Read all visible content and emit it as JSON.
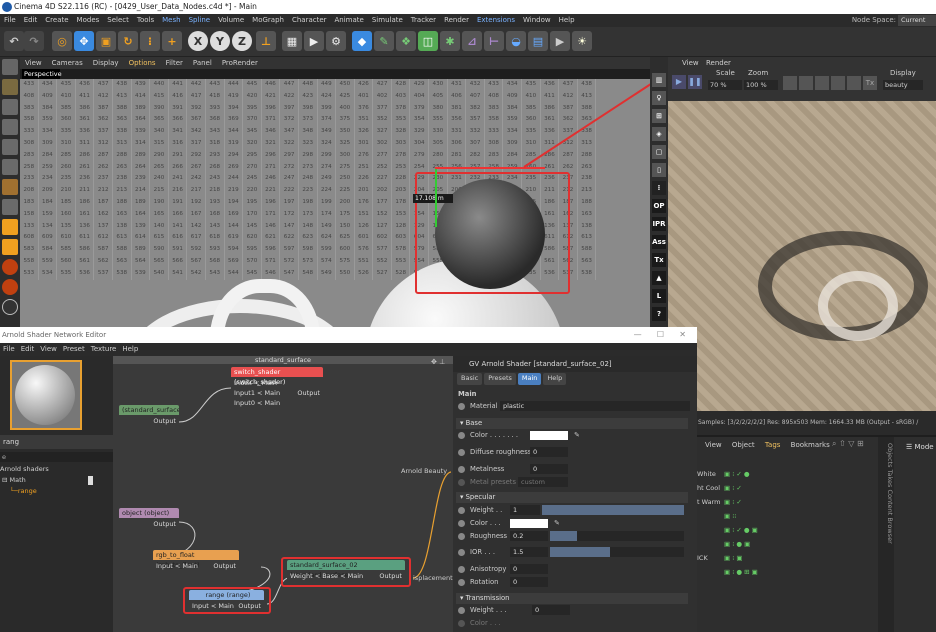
{
  "window": {
    "title": "Cinema 4D S22.116 (RC) - [0429_User_Data_Nodes.c4d *] - Main",
    "node_space_label": "Node Space:",
    "node_space_value": "Current"
  },
  "menu": [
    "File",
    "Edit",
    "Create",
    "Modes",
    "Select",
    "Tools",
    "Mesh",
    "Spline",
    "Volume",
    "MoGraph",
    "Character",
    "Animate",
    "Simulate",
    "Tracker",
    "Render",
    "Extensions",
    "Window",
    "Help"
  ],
  "menu_highlight": [
    "Mesh",
    "Spline",
    "Extensions"
  ],
  "viewport": {
    "menu": [
      "View",
      "Cameras",
      "Display",
      "Options",
      "Filter",
      "Panel",
      "ProRender"
    ],
    "label": "Perspective",
    "grid_rows": [
      [
        "433",
        "434",
        "435",
        "436",
        "437",
        "438",
        "439",
        "440",
        "441",
        "442",
        "443",
        "444",
        "445",
        "446",
        "447",
        "448",
        "449",
        "450",
        "426",
        "427",
        "428",
        "429",
        "430",
        "431",
        "432",
        "433",
        "434",
        "435",
        "436",
        "437",
        "438"
      ],
      [
        "408",
        "409",
        "410",
        "411",
        "412",
        "413",
        "414",
        "415",
        "416",
        "417",
        "418",
        "419",
        "420",
        "421",
        "422",
        "423",
        "424",
        "425",
        "401",
        "402",
        "403",
        "404",
        "405",
        "406",
        "407",
        "408",
        "409",
        "410",
        "411",
        "412",
        "413"
      ],
      [
        "383",
        "384",
        "385",
        "386",
        "387",
        "388",
        "389",
        "390",
        "391",
        "392",
        "393",
        "394",
        "395",
        "396",
        "397",
        "398",
        "399",
        "400",
        "376",
        "377",
        "378",
        "379",
        "380",
        "381",
        "382",
        "383",
        "384",
        "385",
        "386",
        "387",
        "388"
      ],
      [
        "358",
        "359",
        "360",
        "361",
        "362",
        "363",
        "364",
        "365",
        "366",
        "367",
        "368",
        "369",
        "370",
        "371",
        "372",
        "373",
        "374",
        "375",
        "351",
        "352",
        "353",
        "354",
        "355",
        "356",
        "357",
        "358",
        "359",
        "360",
        "361",
        "362",
        "363"
      ],
      [
        "333",
        "334",
        "335",
        "336",
        "337",
        "338",
        "339",
        "340",
        "341",
        "342",
        "343",
        "344",
        "345",
        "346",
        "347",
        "348",
        "349",
        "350",
        "326",
        "327",
        "328",
        "329",
        "330",
        "331",
        "332",
        "333",
        "334",
        "335",
        "336",
        "337",
        "338"
      ],
      [
        "308",
        "309",
        "310",
        "311",
        "312",
        "313",
        "314",
        "315",
        "316",
        "317",
        "318",
        "319",
        "320",
        "321",
        "322",
        "323",
        "324",
        "325",
        "301",
        "302",
        "303",
        "304",
        "305",
        "306",
        "307",
        "308",
        "309",
        "310",
        "311",
        "312",
        "313"
      ],
      [
        "283",
        "284",
        "285",
        "286",
        "287",
        "288",
        "289",
        "290",
        "291",
        "292",
        "293",
        "294",
        "295",
        "296",
        "297",
        "298",
        "299",
        "300",
        "276",
        "277",
        "278",
        "279",
        "280",
        "281",
        "282",
        "283",
        "284",
        "285",
        "286",
        "287",
        "288"
      ],
      [
        "258",
        "259",
        "260",
        "261",
        "262",
        "263",
        "264",
        "265",
        "266",
        "267",
        "268",
        "269",
        "270",
        "271",
        "272",
        "273",
        "274",
        "275",
        "251",
        "252",
        "253",
        "254",
        "255",
        "256",
        "257",
        "258",
        "259",
        "260",
        "261",
        "262",
        "263"
      ],
      [
        "233",
        "234",
        "235",
        "236",
        "237",
        "238",
        "239",
        "240",
        "241",
        "242",
        "243",
        "244",
        "245",
        "246",
        "247",
        "248",
        "249",
        "250",
        "226",
        "227",
        "228",
        "229",
        "230",
        "231",
        "232",
        "233",
        "234",
        "235",
        "236",
        "237",
        "238"
      ],
      [
        "208",
        "209",
        "210",
        "211",
        "212",
        "213",
        "214",
        "215",
        "216",
        "217",
        "218",
        "219",
        "220",
        "221",
        "222",
        "223",
        "224",
        "225",
        "201",
        "202",
        "203",
        "204",
        "205",
        "206",
        "207",
        "208",
        "209",
        "210",
        "211",
        "212",
        "213"
      ],
      [
        "183",
        "184",
        "185",
        "186",
        "187",
        "188",
        "189",
        "190",
        "191",
        "192",
        "193",
        "194",
        "195",
        "196",
        "197",
        "198",
        "199",
        "200",
        "176",
        "177",
        "178",
        "179",
        "180",
        "181",
        "182",
        "183",
        "184",
        "185",
        "186",
        "187",
        "188"
      ],
      [
        "158",
        "159",
        "160",
        "161",
        "162",
        "163",
        "164",
        "165",
        "166",
        "167",
        "168",
        "169",
        "170",
        "171",
        "172",
        "173",
        "174",
        "175",
        "151",
        "152",
        "153",
        "154",
        "155",
        "156",
        "157",
        "158",
        "159",
        "160",
        "161",
        "162",
        "163"
      ],
      [
        "133",
        "134",
        "135",
        "136",
        "137",
        "138",
        "139",
        "140",
        "141",
        "142",
        "143",
        "144",
        "145",
        "146",
        "147",
        "148",
        "149",
        "150",
        "126",
        "127",
        "128",
        "129",
        "130",
        "131",
        "132",
        "133",
        "134",
        "135",
        "136",
        "137",
        "138"
      ],
      [
        "608",
        "609",
        "610",
        "611",
        "612",
        "613",
        "614",
        "615",
        "616",
        "617",
        "618",
        "619",
        "620",
        "621",
        "622",
        "623",
        "624",
        "625",
        "601",
        "602",
        "603",
        "604",
        "605",
        "606",
        "607",
        "608",
        "609",
        "610",
        "611",
        "612",
        "613"
      ],
      [
        "583",
        "584",
        "585",
        "586",
        "587",
        "588",
        "589",
        "590",
        "591",
        "592",
        "593",
        "594",
        "595",
        "596",
        "597",
        "598",
        "599",
        "600",
        "576",
        "577",
        "578",
        "579",
        "580",
        "581",
        "582",
        "583",
        "584",
        "585",
        "586",
        "587",
        "588"
      ],
      [
        "558",
        "559",
        "560",
        "561",
        "562",
        "563",
        "564",
        "565",
        "566",
        "567",
        "568",
        "569",
        "570",
        "571",
        "572",
        "573",
        "574",
        "575",
        "551",
        "552",
        "553",
        "554",
        "555",
        "556",
        "557",
        "558",
        "559",
        "560",
        "561",
        "562",
        "563"
      ],
      [
        "533",
        "534",
        "535",
        "536",
        "537",
        "538",
        "539",
        "540",
        "541",
        "542",
        "543",
        "544",
        "545",
        "546",
        "547",
        "548",
        "549",
        "550",
        "526",
        "527",
        "528",
        "529",
        "530",
        "531",
        "532",
        "533",
        "534",
        "535",
        "536",
        "537",
        "538"
      ]
    ],
    "coord_readout": "17.108 m"
  },
  "right_icons": [
    "OP",
    "IPR",
    "Ass",
    "Tx",
    "L",
    "?"
  ],
  "render": {
    "menu": [
      "View",
      "Render"
    ],
    "scale_label": "Scale",
    "scale_value": "70 %",
    "zoom_label": "Zoom",
    "zoom_value": "100 %",
    "display_label": "Display",
    "display_value": "beauty",
    "status": "Samples: [3/2/2/2/2/2]  Res: 895x503  Mem: 1664.33 MB  (Output - sRGB) / Pixel: 1"
  },
  "object_manager": {
    "tabs": [
      "View",
      "Object",
      "Tags",
      "Bookmarks"
    ],
    "rows": [
      "White",
      "ht Cool",
      "t Warm",
      "",
      "",
      "",
      "ICK",
      ""
    ],
    "side_tabs": "Objects  Takes  Content Browser",
    "mode_label": "Mode"
  },
  "sne": {
    "title": "Arnold Shader Network Editor",
    "menu": [
      "File",
      "Edit",
      "View",
      "Preset",
      "Texture",
      "Help"
    ],
    "search": "rang",
    "tree_root": "Arnold shaders",
    "tree_item": "Math",
    "tree_leaf": "range",
    "canvas_title": "standard_surface",
    "nodes": {
      "switch": {
        "title": "switch_shader (switch_shader)",
        "ports": [
          "Index < Main",
          "Input1 < Main",
          "Input0 < Main"
        ],
        "out": "Output"
      },
      "std": {
        "title": "(standard_surface",
        "out": "Output"
      },
      "object": {
        "title": "object (object)",
        "out": "Output"
      },
      "rgb": {
        "title": "rgb_to_float (rgb_to_float)",
        "in": "Input < Main",
        "out": "Output"
      },
      "range": {
        "title": "range (range)",
        "in": "Input < Main",
        "out": "Output"
      },
      "std02": {
        "title": "standard_surface_02 (standard_surface",
        "in": "Weight < Base < Main",
        "out": "Output"
      },
      "beauty": "Arnold Beauty",
      "displacement": "isplacement"
    }
  },
  "props": {
    "header": "GV Arnold Shader [standard_surface_02]",
    "tabs": [
      "Basic",
      "Presets",
      "Main",
      "Help"
    ],
    "active_tab": "Main",
    "section": "Main",
    "material_label": "Material",
    "material_value": "plastic",
    "base": "Base",
    "color": "Color . . . . . . .",
    "diffuse": "Diffuse roughness",
    "metal": "Metalness",
    "metal_presets": "Metal presets",
    "metal_presets_value": "custom",
    "specular": "Specular",
    "weight": "Weight . .",
    "weight_value": "1",
    "spec_color": "Color . . .",
    "roughness": "Roughness",
    "roughness_value": "0.2",
    "ior": "IOR . . .",
    "ior_value": "1.5",
    "aniso": "Anisotropy",
    "aniso_value": "0",
    "rotation": "Rotation",
    "rotation_value": "0",
    "transmission": "Transmission",
    "t_weight": "Weight . . .",
    "t_weight_value": "0",
    "t_color": "Color . . .",
    "zero": "0",
    "weight_fill": 1.0,
    "roughness_fill": 0.2,
    "ior_fill": 0.45
  }
}
